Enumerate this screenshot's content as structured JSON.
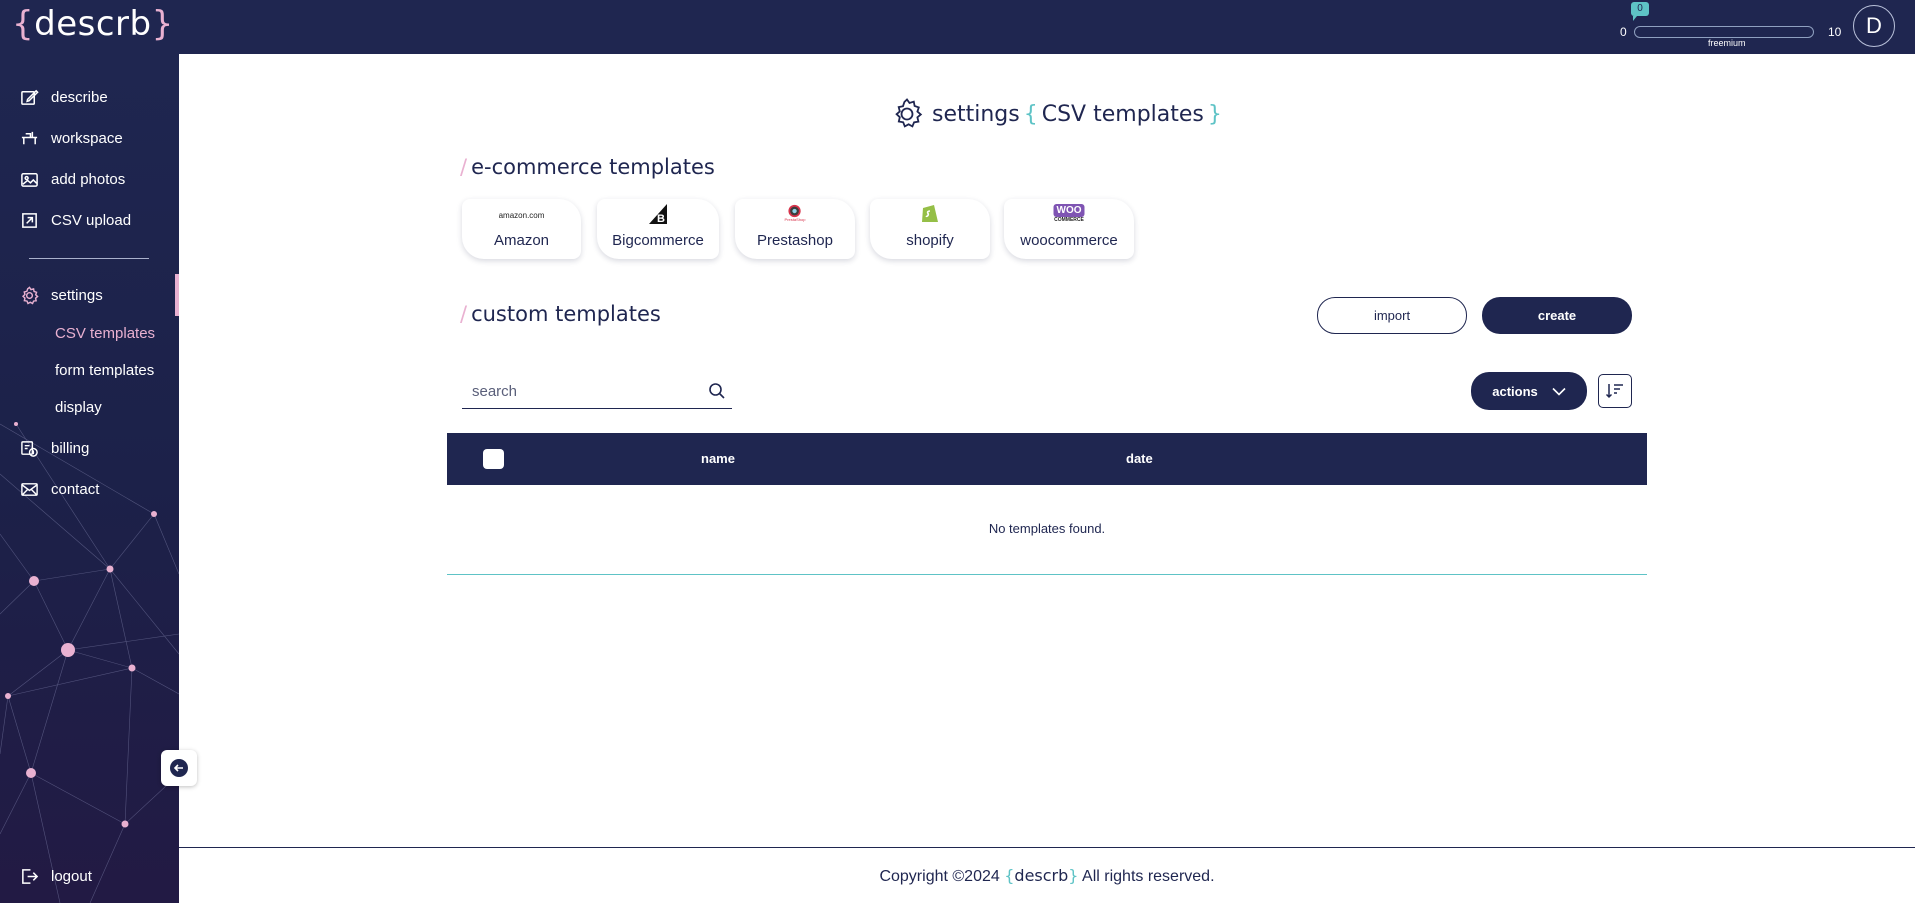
{
  "header": {
    "logo_open": "{",
    "logo_text": "descrb",
    "logo_close": "}",
    "credits": {
      "used": "0",
      "min": "0",
      "max": "10",
      "plan": "freemium",
      "fraction": 0
    },
    "avatar_initial": "D"
  },
  "sidebar": {
    "items": [
      {
        "label": "describe",
        "icon": "edit-icon"
      },
      {
        "label": "workspace",
        "icon": "workspace-icon"
      },
      {
        "label": "add photos",
        "icon": "image-icon"
      },
      {
        "label": "CSV upload",
        "icon": "upload-icon"
      },
      {
        "label": "settings",
        "icon": "gear-icon"
      },
      {
        "label": "billing",
        "icon": "billing-icon"
      },
      {
        "label": "contact",
        "icon": "envelope-icon"
      }
    ],
    "sub_items": [
      {
        "label": "CSV templates",
        "active": true
      },
      {
        "label": "form templates",
        "active": false
      },
      {
        "label": "display",
        "active": false
      }
    ],
    "logout_label": "logout",
    "accent_color": "#e9b1d1"
  },
  "main": {
    "title_prefix": "settings",
    "title_open": "{",
    "title_text": "CSV templates",
    "title_close": "}",
    "ecommerce": {
      "slash": "/",
      "title": "e-commerce templates",
      "templates": [
        {
          "label": "Amazon",
          "logo_text": "amazon.com",
          "icon": "amazon-logo"
        },
        {
          "label": "Bigcommerce",
          "logo_text": "",
          "icon": "bigcommerce-logo"
        },
        {
          "label": "Prestashop",
          "logo_text": "PrestaShop",
          "icon": "prestashop-logo"
        },
        {
          "label": "shopify",
          "logo_text": "",
          "icon": "shopify-logo"
        },
        {
          "label": "woocommerce",
          "logo_text": "WOO",
          "logo_subtext": "COMMERCE",
          "icon": "woocommerce-logo"
        }
      ]
    },
    "custom": {
      "slash": "/",
      "title": "custom templates",
      "import_label": "import",
      "create_label": "create",
      "search_placeholder": "search",
      "actions_label": "actions",
      "columns": [
        "name",
        "date"
      ],
      "empty_message": "No templates found."
    }
  },
  "footer": {
    "prefix": "Copyright ©2024",
    "brand_open": "{",
    "brand_text": "descrb",
    "brand_close": "}",
    "suffix": "All rights reserved."
  },
  "colors": {
    "navy": "#1f2650",
    "pink": "#e9b1d1",
    "teal": "#5ec3c6"
  }
}
